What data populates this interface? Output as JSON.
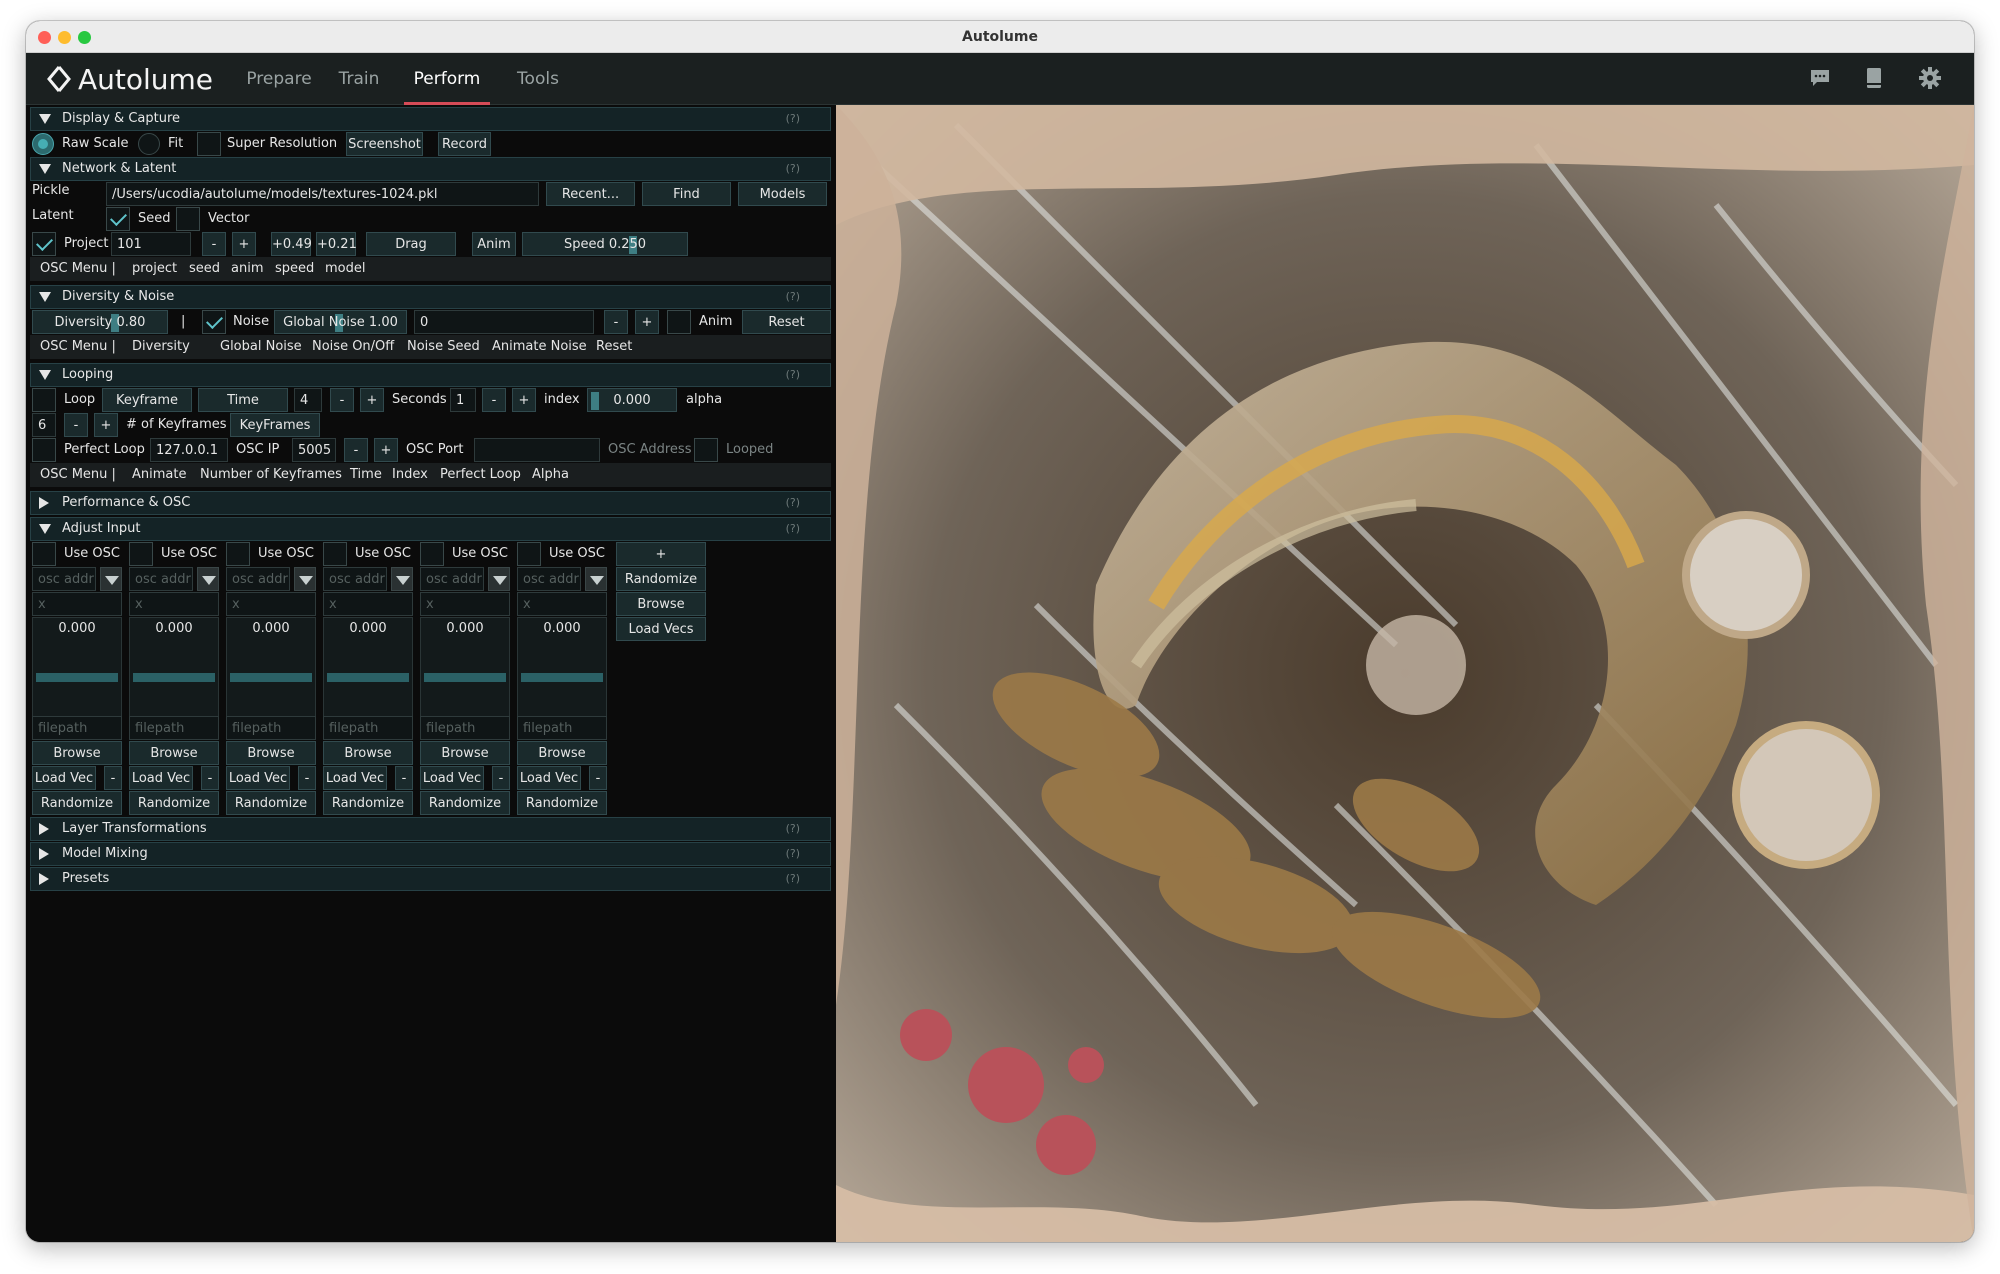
{
  "window": {
    "title": "Autolume"
  },
  "colors": {
    "accent": "#d64b57",
    "teal": "#46aeb4",
    "panel_bg": "#0b0b0b",
    "header_bg": "#142326"
  },
  "app": {
    "logo": "Autolume",
    "tabs": [
      {
        "label": "Prepare"
      },
      {
        "label": "Train"
      },
      {
        "label": "Perform"
      },
      {
        "label": "Tools"
      }
    ],
    "active_tab": "Perform",
    "icons": [
      "chat-icon",
      "book-icon",
      "gear-icon"
    ]
  },
  "help": "(?)",
  "display": {
    "title": "Display & Capture",
    "raw_scale": "Raw Scale",
    "fit": "Fit",
    "super_resolution": "Super Resolution",
    "screenshot": "Screenshot",
    "record": "Record"
  },
  "network": {
    "title": "Network & Latent",
    "pickle_label": "Pickle",
    "pickle_value": "/Users/ucodia/autolume/models/textures-1024.pkl",
    "recent": "Recent...",
    "find": "Find",
    "models": "Models",
    "latent_label": "Latent",
    "seed": "Seed",
    "vector": "Vector",
    "project": "Project",
    "project_value": "101",
    "minus": "-",
    "plus": "+",
    "dx": "+0.49",
    "dy": "+0.21",
    "drag": "Drag",
    "anim": "Anim",
    "speed": "Speed 0.250",
    "osc_menu": [
      "OSC Menu |",
      "project",
      "seed",
      "anim",
      "speed",
      "model"
    ]
  },
  "diversity": {
    "title": "Diversity & Noise",
    "diversity": "Diversity 0.80",
    "sep": "|",
    "noise": "Noise",
    "global_noise": "Global Noise 1.00",
    "seed_value": "0",
    "minus": "-",
    "plus": "+",
    "anim": "Anim",
    "reset": "Reset",
    "osc_menu": [
      "OSC Menu |",
      "Diversity",
      "Global Noise",
      "Noise On/Off",
      "Noise Seed",
      "Animate Noise",
      "Reset"
    ]
  },
  "looping": {
    "title": "Looping",
    "loop": "Loop",
    "keyframe": "Keyframe",
    "time": "Time",
    "time_value": "4",
    "minus": "-",
    "plus": "+",
    "seconds": "Seconds",
    "seconds_value": "1",
    "index": "index",
    "index_value": "0.000",
    "alpha": "alpha",
    "keyframes_value": "6",
    "num_keyframes": "# of Keyframes",
    "keyframes_btn": "KeyFrames",
    "perfect_loop": "Perfect Loop",
    "ip_value": "127.0.0.1",
    "osc_ip": "OSC IP",
    "port_value": "5005",
    "osc_port": "OSC Port",
    "osc_address": "OSC Address",
    "looped": "Looped",
    "osc_menu": [
      "OSC Menu |",
      "Animate",
      "Number of Keyframes",
      "Time",
      "Index",
      "Perfect Loop",
      "Alpha"
    ]
  },
  "performance": {
    "title": "Performance & OSC"
  },
  "adjust": {
    "title": "Adjust Input",
    "use_osc": "Use OSC",
    "plus": "+",
    "osc_addr_ph": "osc addr",
    "x_ph": "x",
    "slider_value": "0.000",
    "filepath_ph": "filepath",
    "browse": "Browse",
    "load_vec": "Load Vec",
    "minus": "-",
    "randomize": "Randomize",
    "side_randomize": "Randomize",
    "side_browse": "Browse",
    "side_load_vecs": "Load Vecs",
    "columns": 6
  },
  "layer": {
    "title": "Layer Transformations"
  },
  "mixing": {
    "title": "Model Mixing"
  },
  "presets": {
    "title": "Presets"
  }
}
